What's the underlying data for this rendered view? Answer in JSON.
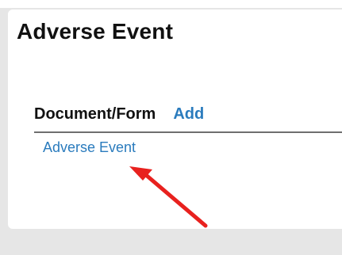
{
  "panel": {
    "title": "Adverse Event"
  },
  "section": {
    "label": "Document/Form",
    "add_label": "Add"
  },
  "documents": [
    {
      "label": "Adverse Event"
    }
  ],
  "annotation": {
    "arrow_color": "#e8211e"
  },
  "colors": {
    "link": "#2a7bbd",
    "background": "#e6e6e6",
    "panel": "#ffffff"
  }
}
